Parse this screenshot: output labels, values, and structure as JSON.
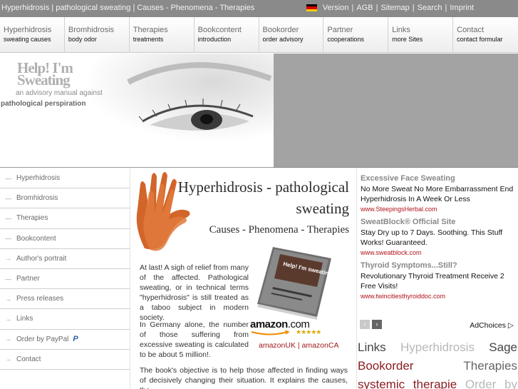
{
  "topbar": {
    "site_title": "Hyperhidrosis | pathological sweating | Causes - Phenomena - Therapies",
    "links": [
      {
        "label": "Version"
      },
      {
        "label": "|"
      },
      {
        "label": "AGB"
      },
      {
        "label": "|"
      },
      {
        "label": "Sitemap"
      },
      {
        "label": "|"
      },
      {
        "label": "Search"
      },
      {
        "label": "|"
      },
      {
        "label": "Imprint"
      }
    ],
    "flag_colors": [
      "#000000",
      "#dd0000",
      "#ffce00"
    ]
  },
  "nav": [
    {
      "title": "Hyperhidrosis",
      "sub": "sweating causes"
    },
    {
      "title": "Bromhidrosis",
      "sub": "body odor"
    },
    {
      "title": "Therapies",
      "sub": "treatments"
    },
    {
      "title": "Bookcontent",
      "sub": "introduction"
    },
    {
      "title": "Bookorder",
      "sub": "order advisory"
    },
    {
      "title": "Partner",
      "sub": "cooperations"
    },
    {
      "title": "Links",
      "sub": "more Sites"
    },
    {
      "title": "Contact",
      "sub": "contact formular"
    }
  ],
  "header": {
    "logo_title": "Help! I'm Sweating",
    "logo_sub1": "an advisory manual against",
    "logo_sub2": "pathological perspiration"
  },
  "sidebar": [
    {
      "mark": "—",
      "label": "Hyperhidrosis"
    },
    {
      "mark": "—",
      "label": "Bromhidrosis"
    },
    {
      "mark": "—",
      "label": "Therapies"
    },
    {
      "mark": "—",
      "label": "Bookcontent"
    },
    {
      "mark": "→",
      "label": "Author's portrait"
    },
    {
      "mark": "—",
      "label": "Partner"
    },
    {
      "mark": "→",
      "label": "Press releases"
    },
    {
      "mark": "→",
      "label": "Links"
    },
    {
      "mark": "→",
      "label": "Order by PayPal"
    },
    {
      "mark": "→",
      "label": "Contact"
    }
  ],
  "main": {
    "heading_line1": "Hyperhidrosis - pathological",
    "heading_line2": "sweating",
    "subheading": "Causes - Phenomena - Therapies",
    "para1": "At last! A sigh of relief from many of the affected. Pathological sweating, or in technical terms \"hyperhidrosis\" is still treated as a taboo subject in modern society.",
    "para2": "In Germany alone, the number of those suffering from excessive sweating is calculated to be about 5 million!.",
    "para3": "The book's objective is to help those affected in finding ways of decisively changing their situation. It explains the causes, the",
    "book_cover_title": "Help! I'm sweating!",
    "amazon_logo": "amazon",
    "amazon_logo_suffix": ".com",
    "amazon_links": "amazonUK | amazonCA",
    "star_rating": 5
  },
  "ads": {
    "items": [
      {
        "title": "Excessive Face Sweating",
        "body": "No More Sweat No More Embarrassment End Hyperhidrosis In A Week Or Less",
        "url": "www.SteepingsHerbal.com"
      },
      {
        "title": "SweatBlock® Official Site",
        "body": "Stay Dry up to 7 Days. Soothing. This Stuff Works! Guaranteed.",
        "url": "www.sweatblock.com"
      },
      {
        "title": "Thyroid Symptoms...Still?",
        "body": "Revolutionary Thyroid Treatment Receive 2 Free Visits!",
        "url": "www.twincitiesthyroiddoc.com"
      }
    ],
    "adchoices_label": "AdChoices ▷",
    "prev_icon": "‹",
    "next_icon": "›"
  },
  "tagcloud": {
    "rows": [
      [
        {
          "label": "Links",
          "tone": "dark"
        },
        {
          "label": "Hyperhidrosis",
          "tone": "light"
        },
        {
          "label": "Sage",
          "tone": "dark"
        }
      ],
      [
        {
          "label": "Bookorder",
          "tone": "red"
        },
        {
          "label": "Therapies",
          "tone": "mid"
        }
      ],
      [
        {
          "label": "systemic",
          "tone": "red"
        },
        {
          "label": "therapie",
          "tone": "red"
        },
        {
          "label": "Order",
          "tone": "light"
        },
        {
          "label": "by",
          "tone": "light"
        }
      ]
    ]
  }
}
